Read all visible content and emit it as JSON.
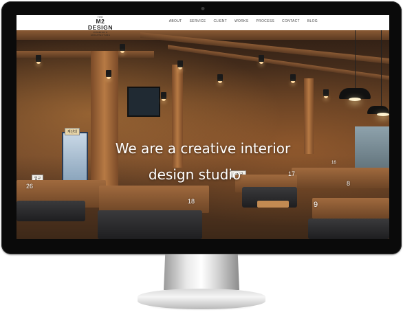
{
  "site": {
    "logo": {
      "small": "THE",
      "name": "M2 DESIGN",
      "tagline": "INTERIOR & ARCHITECTURE"
    },
    "nav": [
      "ABOUT",
      "SERVICE",
      "CLIENT",
      "WORKS",
      "PROCESS",
      "CONTACT",
      "BLOG"
    ],
    "hero": {
      "line1": "We are a creative interior",
      "line2": "design studio"
    }
  },
  "photo": {
    "booth_numbers": [
      "26",
      "18",
      "17",
      "16",
      "8",
      "9"
    ],
    "signs": [
      "입구",
      "← 출구",
      "계산대"
    ]
  }
}
